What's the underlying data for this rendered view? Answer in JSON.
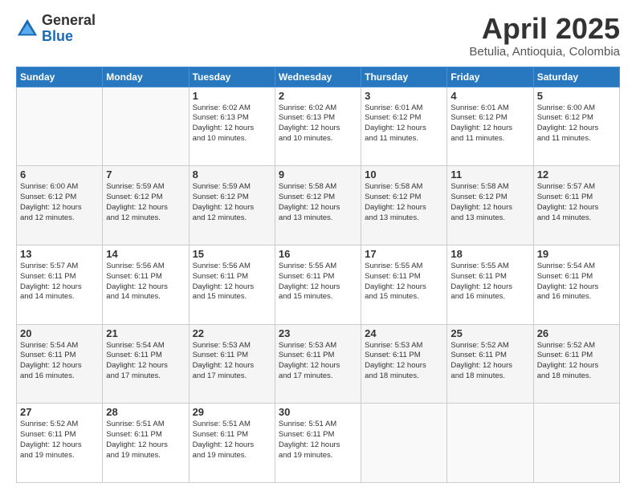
{
  "header": {
    "logo_general": "General",
    "logo_blue": "Blue",
    "month_title": "April 2025",
    "location": "Betulia, Antioquia, Colombia"
  },
  "weekdays": [
    "Sunday",
    "Monday",
    "Tuesday",
    "Wednesday",
    "Thursday",
    "Friday",
    "Saturday"
  ],
  "weeks": [
    [
      {
        "day": "",
        "info": ""
      },
      {
        "day": "",
        "info": ""
      },
      {
        "day": "1",
        "info": "Sunrise: 6:02 AM\nSunset: 6:13 PM\nDaylight: 12 hours\nand 10 minutes."
      },
      {
        "day": "2",
        "info": "Sunrise: 6:02 AM\nSunset: 6:13 PM\nDaylight: 12 hours\nand 10 minutes."
      },
      {
        "day": "3",
        "info": "Sunrise: 6:01 AM\nSunset: 6:12 PM\nDaylight: 12 hours\nand 11 minutes."
      },
      {
        "day": "4",
        "info": "Sunrise: 6:01 AM\nSunset: 6:12 PM\nDaylight: 12 hours\nand 11 minutes."
      },
      {
        "day": "5",
        "info": "Sunrise: 6:00 AM\nSunset: 6:12 PM\nDaylight: 12 hours\nand 11 minutes."
      }
    ],
    [
      {
        "day": "6",
        "info": "Sunrise: 6:00 AM\nSunset: 6:12 PM\nDaylight: 12 hours\nand 12 minutes."
      },
      {
        "day": "7",
        "info": "Sunrise: 5:59 AM\nSunset: 6:12 PM\nDaylight: 12 hours\nand 12 minutes."
      },
      {
        "day": "8",
        "info": "Sunrise: 5:59 AM\nSunset: 6:12 PM\nDaylight: 12 hours\nand 12 minutes."
      },
      {
        "day": "9",
        "info": "Sunrise: 5:58 AM\nSunset: 6:12 PM\nDaylight: 12 hours\nand 13 minutes."
      },
      {
        "day": "10",
        "info": "Sunrise: 5:58 AM\nSunset: 6:12 PM\nDaylight: 12 hours\nand 13 minutes."
      },
      {
        "day": "11",
        "info": "Sunrise: 5:58 AM\nSunset: 6:12 PM\nDaylight: 12 hours\nand 13 minutes."
      },
      {
        "day": "12",
        "info": "Sunrise: 5:57 AM\nSunset: 6:11 PM\nDaylight: 12 hours\nand 14 minutes."
      }
    ],
    [
      {
        "day": "13",
        "info": "Sunrise: 5:57 AM\nSunset: 6:11 PM\nDaylight: 12 hours\nand 14 minutes."
      },
      {
        "day": "14",
        "info": "Sunrise: 5:56 AM\nSunset: 6:11 PM\nDaylight: 12 hours\nand 14 minutes."
      },
      {
        "day": "15",
        "info": "Sunrise: 5:56 AM\nSunset: 6:11 PM\nDaylight: 12 hours\nand 15 minutes."
      },
      {
        "day": "16",
        "info": "Sunrise: 5:55 AM\nSunset: 6:11 PM\nDaylight: 12 hours\nand 15 minutes."
      },
      {
        "day": "17",
        "info": "Sunrise: 5:55 AM\nSunset: 6:11 PM\nDaylight: 12 hours\nand 15 minutes."
      },
      {
        "day": "18",
        "info": "Sunrise: 5:55 AM\nSunset: 6:11 PM\nDaylight: 12 hours\nand 16 minutes."
      },
      {
        "day": "19",
        "info": "Sunrise: 5:54 AM\nSunset: 6:11 PM\nDaylight: 12 hours\nand 16 minutes."
      }
    ],
    [
      {
        "day": "20",
        "info": "Sunrise: 5:54 AM\nSunset: 6:11 PM\nDaylight: 12 hours\nand 16 minutes."
      },
      {
        "day": "21",
        "info": "Sunrise: 5:54 AM\nSunset: 6:11 PM\nDaylight: 12 hours\nand 17 minutes."
      },
      {
        "day": "22",
        "info": "Sunrise: 5:53 AM\nSunset: 6:11 PM\nDaylight: 12 hours\nand 17 minutes."
      },
      {
        "day": "23",
        "info": "Sunrise: 5:53 AM\nSunset: 6:11 PM\nDaylight: 12 hours\nand 17 minutes."
      },
      {
        "day": "24",
        "info": "Sunrise: 5:53 AM\nSunset: 6:11 PM\nDaylight: 12 hours\nand 18 minutes."
      },
      {
        "day": "25",
        "info": "Sunrise: 5:52 AM\nSunset: 6:11 PM\nDaylight: 12 hours\nand 18 minutes."
      },
      {
        "day": "26",
        "info": "Sunrise: 5:52 AM\nSunset: 6:11 PM\nDaylight: 12 hours\nand 18 minutes."
      }
    ],
    [
      {
        "day": "27",
        "info": "Sunrise: 5:52 AM\nSunset: 6:11 PM\nDaylight: 12 hours\nand 19 minutes."
      },
      {
        "day": "28",
        "info": "Sunrise: 5:51 AM\nSunset: 6:11 PM\nDaylight: 12 hours\nand 19 minutes."
      },
      {
        "day": "29",
        "info": "Sunrise: 5:51 AM\nSunset: 6:11 PM\nDaylight: 12 hours\nand 19 minutes."
      },
      {
        "day": "30",
        "info": "Sunrise: 5:51 AM\nSunset: 6:11 PM\nDaylight: 12 hours\nand 19 minutes."
      },
      {
        "day": "",
        "info": ""
      },
      {
        "day": "",
        "info": ""
      },
      {
        "day": "",
        "info": ""
      }
    ]
  ]
}
